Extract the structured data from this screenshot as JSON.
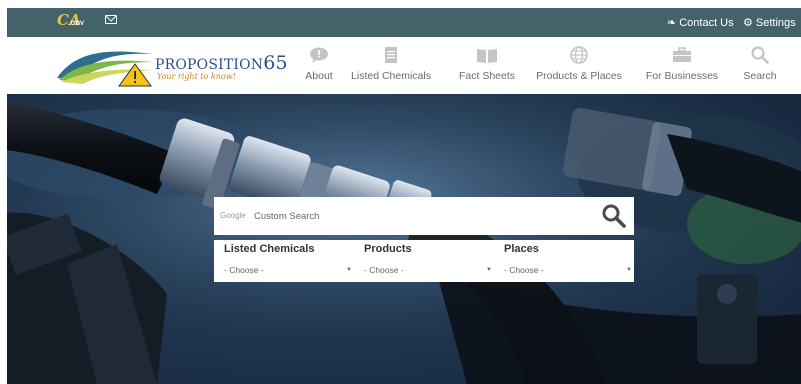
{
  "topbar": {
    "gov_logo_text": "CA.GOV",
    "contact_label": "Contact Us",
    "settings_label": "Settings"
  },
  "logo": {
    "name_main": "PROPOSITION",
    "name_num": "65",
    "tagline": "Your right to know!"
  },
  "nav": {
    "items": [
      {
        "label": "About",
        "icon": "speech-bubble-icon"
      },
      {
        "label": "Listed Chemicals",
        "icon": "document-icon"
      },
      {
        "label": "Fact Sheets",
        "icon": "open-book-icon"
      },
      {
        "label": "Products & Places",
        "icon": "globe-icon"
      },
      {
        "label": "For Businesses",
        "icon": "briefcase-icon"
      },
      {
        "label": "Search",
        "icon": "magnifier-icon"
      }
    ]
  },
  "search": {
    "google_label": "Google",
    "placeholder": "Custom Search"
  },
  "filters": [
    {
      "label": "Listed Chemicals",
      "selected": "- Choose -"
    },
    {
      "label": "Products",
      "selected": "- Choose -"
    },
    {
      "label": "Places",
      "selected": "- Choose -"
    }
  ],
  "colors": {
    "topbar_bg": "#446269",
    "nav_text": "#6b6b6b",
    "brand_blue": "#2e4e8a",
    "brand_gold": "#c68a1c"
  }
}
